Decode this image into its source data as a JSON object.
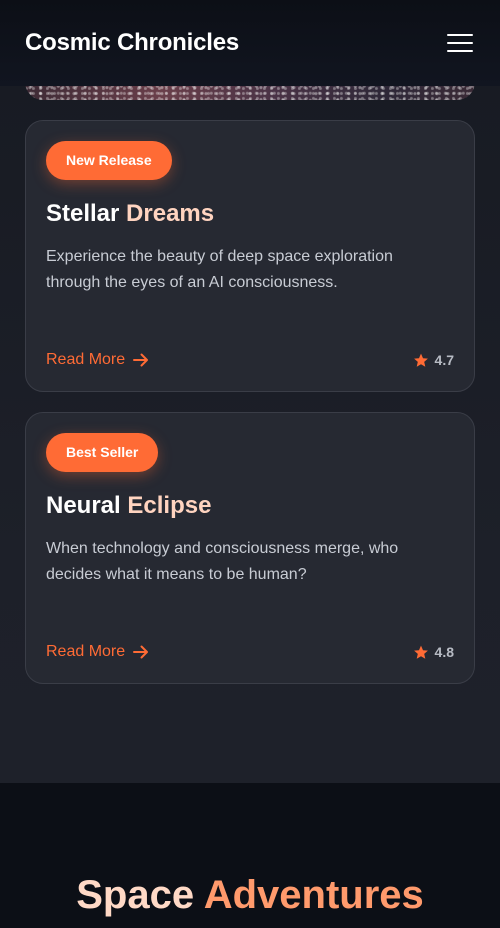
{
  "header": {
    "brand": "Cosmic Chronicles",
    "menu_icon": "hamburger-menu-icon"
  },
  "colors": {
    "accent": "#ff6b35",
    "title_highlight": "#ffd4c0",
    "card_bg": "#262932",
    "page_bg": "#1d2029",
    "header_bg": "#0c0f16"
  },
  "cards": [
    {
      "badge": "New Release",
      "title_word1": "Stellar",
      "title_word2": "Dreams",
      "description": "Experience the beauty of deep space exploration through the eyes of an AI consciousness.",
      "read_more": "Read More",
      "rating": "4.7"
    },
    {
      "badge": "Best Seller",
      "title_word1": "Neural",
      "title_word2": "Eclipse",
      "description": "When technology and consciousness merge, who decides what it means to be human?",
      "read_more": "Read More",
      "rating": "4.8"
    }
  ],
  "section": {
    "title_word1": "Space",
    "title_word2": "Adventures"
  }
}
